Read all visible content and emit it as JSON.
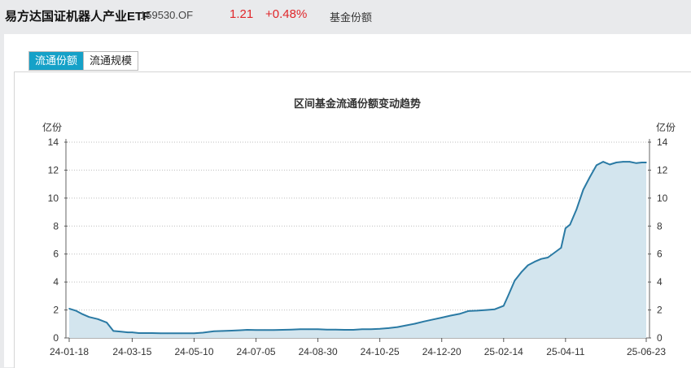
{
  "header": {
    "fund_name": "易方达国证机器人产业ETF",
    "fund_code": "159530.OF",
    "price": "1.21",
    "change_pct": "+0.48%",
    "section": "基金份额"
  },
  "tabs": [
    {
      "label": "流通份额",
      "active": true
    },
    {
      "label": "流通规模",
      "active": false
    }
  ],
  "colors": {
    "accent": "#15a1c8",
    "line": "#2a7aa4",
    "area": "#d3e5ee",
    "up": "#e0262a"
  },
  "chart_data": {
    "type": "area",
    "title": "区间基金流通份额变动趋势",
    "ylabel_left": "亿份",
    "ylabel_right": "亿份",
    "ylim": [
      0,
      14
    ],
    "yticks": [
      0,
      2,
      4,
      6,
      8,
      10,
      12,
      14
    ],
    "grid": true,
    "x_tick_labels": [
      "24-01-18",
      "24-03-15",
      "24-05-10",
      "24-07-05",
      "24-08-30",
      "24-10-25",
      "24-12-20",
      "25-02-14",
      "25-04-11",
      "25-06-23"
    ],
    "series": [
      {
        "x": [
          "24-01-18",
          "24-01-24",
          "24-01-30",
          "24-02-05",
          "24-02-13",
          "24-02-21",
          "24-02-27",
          "24-03-05",
          "24-03-11",
          "24-03-15",
          "24-03-21",
          "24-03-27",
          "24-04-02",
          "24-04-10",
          "24-04-16",
          "24-04-22",
          "24-04-28",
          "24-05-06",
          "24-05-10",
          "24-05-18",
          "24-05-28",
          "24-06-05",
          "24-06-13",
          "24-06-21",
          "24-06-27",
          "24-07-05",
          "24-07-13",
          "24-07-21",
          "24-07-29",
          "24-08-06",
          "24-08-14",
          "24-08-22",
          "24-08-30",
          "24-09-07",
          "24-09-15",
          "24-09-23",
          "24-10-01",
          "24-10-09",
          "24-10-17",
          "24-10-25",
          "24-11-02",
          "24-11-10",
          "24-11-18",
          "24-11-26",
          "24-12-04",
          "24-12-12",
          "24-12-20",
          "24-12-28",
          "25-01-05",
          "25-01-13",
          "25-01-21",
          "25-01-29",
          "25-02-06",
          "25-02-14",
          "25-02-18",
          "25-02-24",
          "25-03-02",
          "25-03-08",
          "25-03-14",
          "25-03-20",
          "25-03-26",
          "25-04-01",
          "25-04-07",
          "25-04-11",
          "25-04-15",
          "25-04-21",
          "25-04-27",
          "25-05-03",
          "25-05-09",
          "25-05-15",
          "25-05-21",
          "25-05-27",
          "25-06-02",
          "25-06-08",
          "25-06-14",
          "25-06-19",
          "25-06-23"
        ],
        "values": [
          2.1,
          1.95,
          1.7,
          1.5,
          1.35,
          1.1,
          0.5,
          0.45,
          0.4,
          0.4,
          0.35,
          0.35,
          0.35,
          0.33,
          0.33,
          0.33,
          0.33,
          0.33,
          0.33,
          0.38,
          0.48,
          0.5,
          0.52,
          0.55,
          0.58,
          0.57,
          0.57,
          0.57,
          0.58,
          0.6,
          0.62,
          0.62,
          0.62,
          0.6,
          0.6,
          0.58,
          0.58,
          0.62,
          0.63,
          0.65,
          0.7,
          0.78,
          0.9,
          1.02,
          1.18,
          1.32,
          1.45,
          1.6,
          1.72,
          1.92,
          1.95,
          2.0,
          2.05,
          2.3,
          3.0,
          4.1,
          4.7,
          5.2,
          5.45,
          5.65,
          5.75,
          6.1,
          6.45,
          7.85,
          8.1,
          9.2,
          10.6,
          11.5,
          12.35,
          12.6,
          12.4,
          12.55,
          12.6,
          12.6,
          12.5,
          12.55,
          12.55
        ]
      }
    ]
  }
}
